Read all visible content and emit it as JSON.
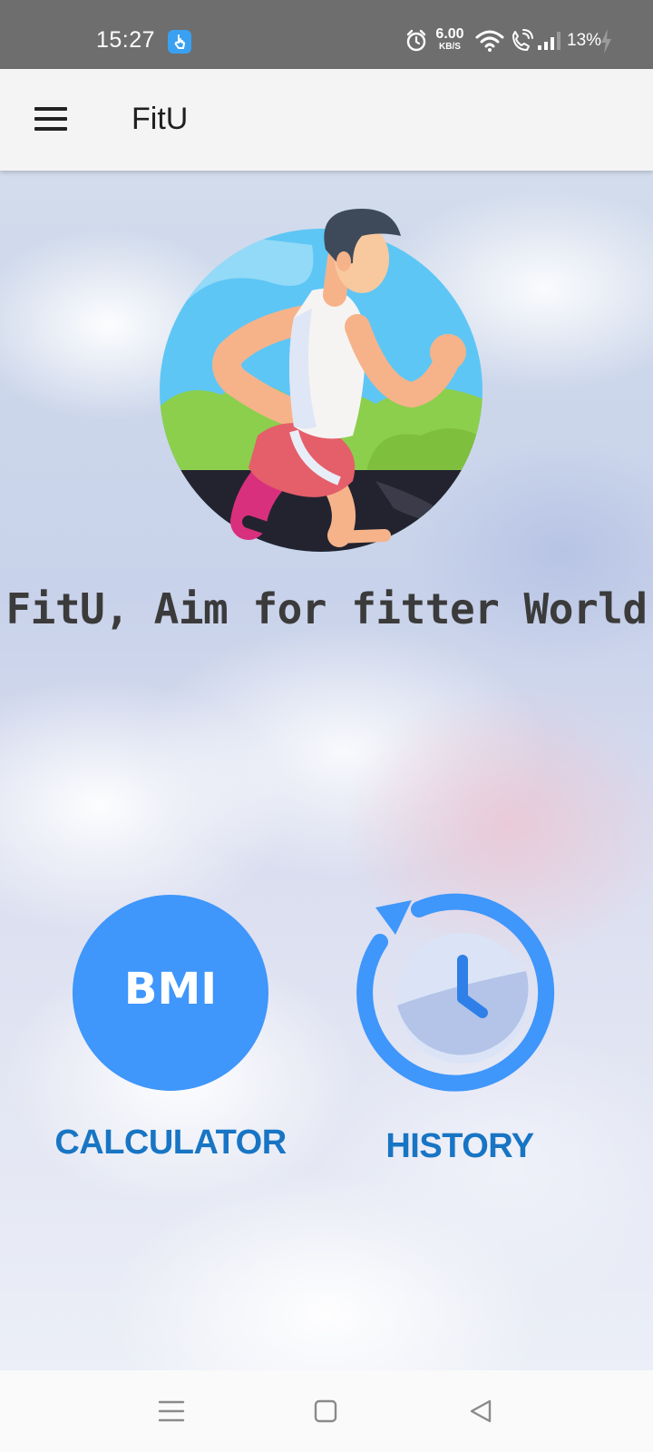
{
  "status_bar": {
    "time": "15:27",
    "speed_value": "6.00",
    "speed_unit": "KB/S",
    "battery": "13%",
    "icons": [
      "app-notification-icon",
      "alarm-icon",
      "wifi-icon",
      "wifi-call-icon",
      "signal-icon",
      "charging-icon"
    ]
  },
  "app_bar": {
    "title": "FitU",
    "menu_icon": "hamburger-menu-icon"
  },
  "main": {
    "hero_icon": "running-man-illustration",
    "tagline": "FitU, Aim for fitter World",
    "bmi_button": {
      "text": "BMI",
      "label": "CALCULATOR",
      "color": "#3f96fb"
    },
    "history_button": {
      "icon": "clock-history-icon",
      "label": "HISTORY",
      "color": "#3f96fb"
    },
    "label_color": "#1875c4"
  },
  "nav_bar": {
    "icons": [
      "recent-apps-icon",
      "home-icon",
      "back-icon"
    ]
  }
}
